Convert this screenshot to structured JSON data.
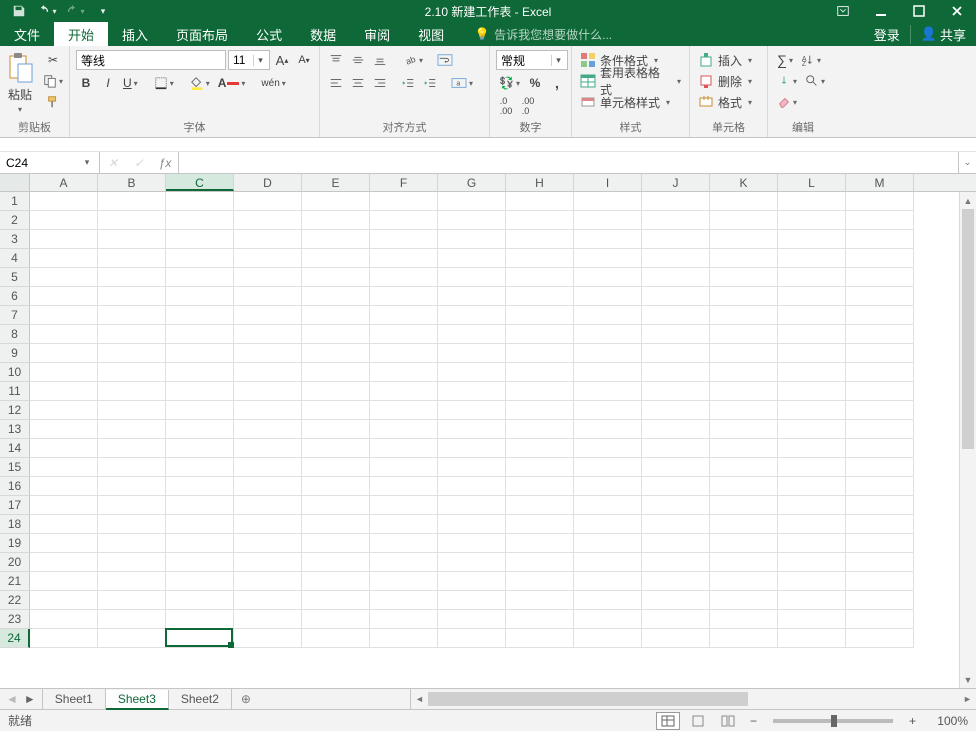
{
  "title": "2.10 新建工作表 - Excel",
  "qat": {
    "save": "save",
    "undo": "undo",
    "redo": "redo"
  },
  "tabs": {
    "file": "文件",
    "items": [
      "开始",
      "插入",
      "页面布局",
      "公式",
      "数据",
      "审阅",
      "视图"
    ],
    "active": "开始",
    "tellme_placeholder": "告诉我您想要做什么...",
    "login": "登录",
    "share": "共享"
  },
  "ribbon": {
    "clipboard": {
      "label": "剪贴板",
      "paste": "粘贴"
    },
    "font": {
      "label": "字体",
      "font_name": "等线",
      "font_size": "11",
      "bold": "B",
      "italic": "I",
      "underline": "U",
      "phonetic": "wén"
    },
    "alignment": {
      "label": "对齐方式"
    },
    "number": {
      "label": "数字",
      "format": "常规",
      "currency": "currency",
      "percent": "%",
      "comma": ",",
      "inc_dec_labels": [
        ".00→.0",
        ".0→.00"
      ]
    },
    "styles": {
      "label": "样式",
      "cond": "条件格式",
      "table": "套用表格格式",
      "cell": "单元格样式"
    },
    "cells": {
      "label": "单元格",
      "insert": "插入",
      "delete": "删除",
      "format": "格式"
    },
    "editing": {
      "label": "编辑"
    }
  },
  "formula_bar": {
    "name_box": "C24",
    "formula": ""
  },
  "grid": {
    "columns": [
      "A",
      "B",
      "C",
      "D",
      "E",
      "F",
      "G",
      "H",
      "I",
      "J",
      "K",
      "L",
      "M"
    ],
    "rows": [
      1,
      2,
      3,
      4,
      5,
      6,
      7,
      8,
      9,
      10,
      11,
      12,
      13,
      14,
      15,
      16,
      17,
      18,
      19,
      20,
      21,
      22,
      23,
      24
    ],
    "active_col": "C",
    "active_row": 24
  },
  "sheets": {
    "items": [
      "Sheet1",
      "Sheet3",
      "Sheet2"
    ],
    "active": "Sheet3"
  },
  "status": {
    "ready": "就绪",
    "zoom": "100%"
  }
}
